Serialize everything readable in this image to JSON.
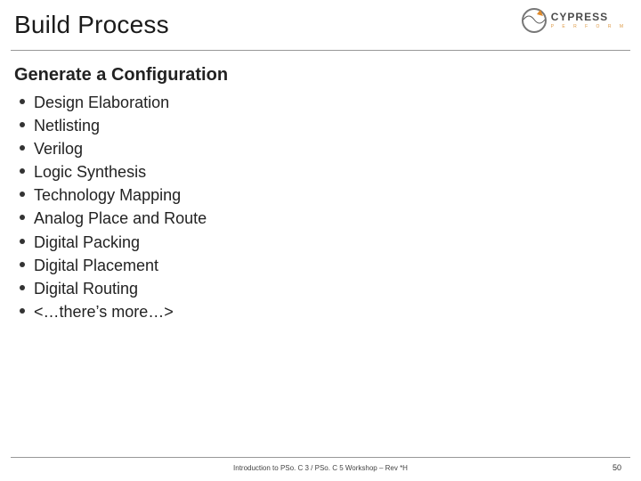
{
  "header": {
    "title": "Build Process",
    "logo": {
      "brand": "CYPRESS",
      "tagline": "P E R F O R M"
    }
  },
  "content": {
    "subtitle": "Generate a Configuration",
    "bullets": [
      "Design Elaboration",
      "Netlisting",
      "Verilog",
      "Logic Synthesis",
      "Technology Mapping",
      "Analog Place and Route",
      "Digital Packing",
      "Digital Placement",
      "Digital Routing",
      "<…there’s more…>"
    ]
  },
  "footer": {
    "center": "Introduction to PSo. C 3 / PSo. C 5 Workshop – Rev *H",
    "page": "50"
  }
}
